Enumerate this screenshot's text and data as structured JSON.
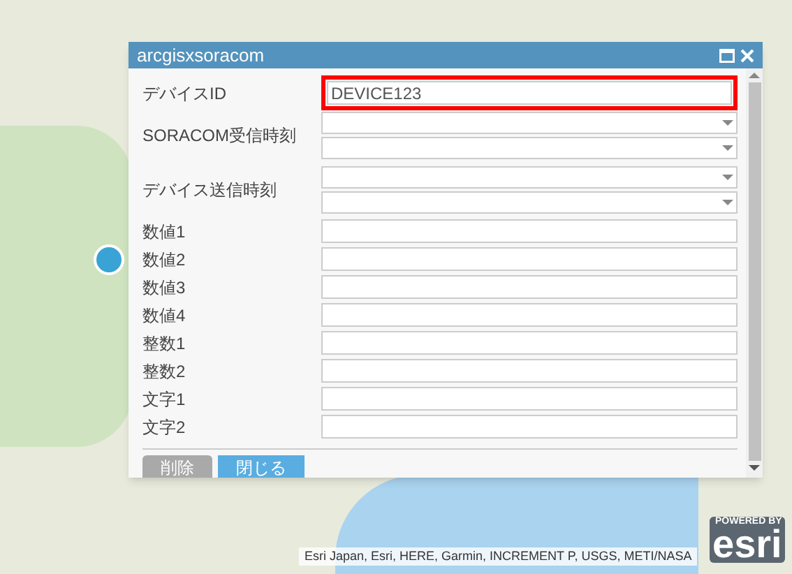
{
  "popup": {
    "title": "arcgisxsoracom",
    "fields": [
      {
        "kind": "text",
        "label": "デバイスID",
        "value": "DEVICE123",
        "highlighted": true
      },
      {
        "kind": "datetime",
        "label": "SORACOM受信時刻",
        "highlighted": false
      },
      {
        "kind": "datetime",
        "label": "デバイス送信時刻",
        "highlighted": false
      },
      {
        "kind": "text",
        "label": "数値1",
        "highlighted": false
      },
      {
        "kind": "text",
        "label": "数値2",
        "highlighted": false
      },
      {
        "kind": "text",
        "label": "数値3",
        "highlighted": false
      },
      {
        "kind": "text",
        "label": "数値4",
        "highlighted": false
      },
      {
        "kind": "text",
        "label": "整数1",
        "highlighted": false
      },
      {
        "kind": "text",
        "label": "整数2",
        "highlighted": false
      },
      {
        "kind": "text",
        "label": "文字1",
        "highlighted": false
      },
      {
        "kind": "text",
        "label": "文字2",
        "highlighted": false
      }
    ],
    "buttons": [
      {
        "label": "削除",
        "kind": "secondary"
      },
      {
        "label": "閉じる",
        "kind": "primary"
      }
    ]
  },
  "map": {
    "attribution": "Esri Japan, Esri, HERE, Garmin, INCREMENT P, USGS, METI/NASA",
    "logo_caption": "POWERED BY",
    "logo": "esri"
  }
}
